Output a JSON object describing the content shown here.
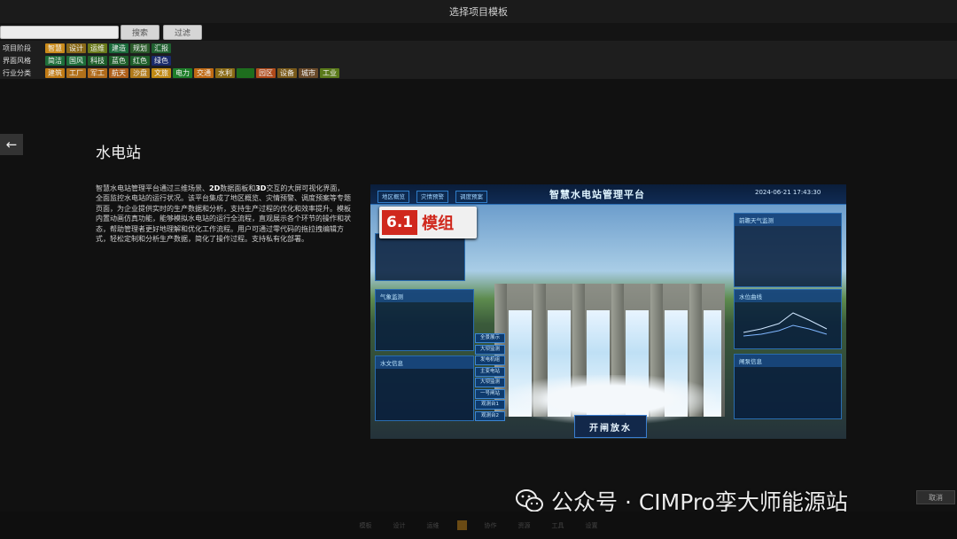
{
  "window": {
    "title": "选择项目模板"
  },
  "toolbar": {
    "search_placeholder": "",
    "search_button": "搜索",
    "filter_button": "过滤"
  },
  "filters": {
    "stage": {
      "label": "项目阶段",
      "tags": [
        {
          "text": "智慧",
          "color": "#c98a1a"
        },
        {
          "text": "设计",
          "color": "#8a6a1a"
        },
        {
          "text": "运维",
          "color": "#6a7a1a"
        },
        {
          "text": "建造",
          "color": "#1a6a3a"
        },
        {
          "text": "规划",
          "color": "#2a5a2a"
        },
        {
          "text": "汇报",
          "color": "#1f5f2f"
        }
      ]
    },
    "style": {
      "label": "界面风格",
      "tags": [
        {
          "text": "简洁",
          "color": "#1e6e3a"
        },
        {
          "text": "国风",
          "color": "#1e6e3a"
        },
        {
          "text": "科技",
          "color": "#1e5e2a"
        },
        {
          "text": "蓝色",
          "color": "#1e5e2a"
        },
        {
          "text": "红色",
          "color": "#1e5e2a"
        },
        {
          "text": "绿色",
          "color": "#1a2a6a"
        }
      ]
    },
    "industry": {
      "label": "行业分类",
      "tags": [
        {
          "text": "建筑",
          "color": "#c07a14"
        },
        {
          "text": "工厂",
          "color": "#b0701a"
        },
        {
          "text": "军工",
          "color": "#b06a1a"
        },
        {
          "text": "航天",
          "color": "#b0601a"
        },
        {
          "text": "沙盘",
          "color": "#b07a1a"
        },
        {
          "text": "文旅",
          "color": "#c08a14"
        },
        {
          "text": "电力",
          "color": "#1e7e2a"
        },
        {
          "text": "交通",
          "color": "#c06a14"
        },
        {
          "text": "水利",
          "color": "#8a6a14"
        },
        {
          "text": "",
          "color": "#1e6e1e"
        },
        {
          "text": "园区",
          "color": "#b04a1a"
        },
        {
          "text": "设备",
          "color": "#7a5a1a"
        },
        {
          "text": "城市",
          "color": "#6a4a2a"
        },
        {
          "text": "工业",
          "color": "#5a7a1a"
        }
      ]
    }
  },
  "detail": {
    "title": "水电站",
    "description_parts": [
      "智慧水电站管理平台通过三维场景、",
      "2D",
      "数据面板和",
      "3D",
      "交互的大屏可视化界面，全面监控水电站的运行状况。该平台集成了地区概览、灾情预警、调度预案等专题页面，为企业提供实时的生产数据和分析，支持生产过程的优化和效率提升。模板内置动画仿真功能，能够模拟水电站的运行全流程，直观展示各个环节的操作和状态，帮助管理者更好地理解和优化工作流程。用户可通过零代码的拖拉拽编辑方式，轻松定制和分析生产数据，简化了操作过程。支持私有化部署。"
    ]
  },
  "preview": {
    "tabs": [
      "地区概览",
      "灾情预警",
      "调度预案"
    ],
    "title": "智慧水电站管理平台",
    "time": "2024-06-21 17:43:30",
    "badge_num": "6.1",
    "badge_text": "模组",
    "panel_weather": "气象监测",
    "panel_hydro": "水文信息",
    "panel_forecast": "前瞻天气监测",
    "panel_curve": "水位曲线",
    "panel_gate": "闸泵信息",
    "side_items": [
      "全景展示",
      "大坝监测",
      "发电机组",
      "主变电站",
      "大坝监测",
      "一号闸站",
      "观测台1",
      "观测台2"
    ],
    "open_button": "开闸放水"
  },
  "watermark": {
    "text": "公众号 · CIMPro孪大师能源站"
  },
  "cancel_label": "取消",
  "bottombar": {
    "items": [
      "模板",
      "设计",
      "运维",
      "协作",
      "资源",
      "工具",
      "设置"
    ]
  }
}
